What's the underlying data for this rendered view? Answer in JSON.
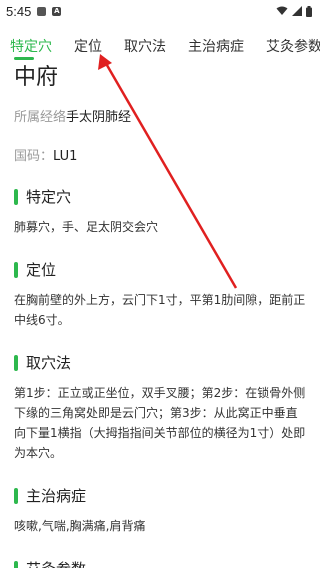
{
  "status_bar": {
    "time": "5:45",
    "left_icons": [
      "image-icon",
      "a-app-icon"
    ],
    "right_icons": [
      "wifi-icon",
      "signal-icon",
      "battery-icon"
    ]
  },
  "tabs": [
    {
      "label": "特定穴",
      "active": true
    },
    {
      "label": "定位",
      "active": false
    },
    {
      "label": "取穴法",
      "active": false
    },
    {
      "label": "主治病症",
      "active": false
    },
    {
      "label": "艾灸参数",
      "active": false
    }
  ],
  "point": {
    "name": "中府",
    "meridian_key": "所属经络",
    "meridian_value": "手太阴肺经",
    "code_key": "国码：",
    "code_value": "LU1"
  },
  "sections": [
    {
      "title": "特定穴",
      "body": "肺募穴，手、足太阴交会穴"
    },
    {
      "title": "定位",
      "body": "在胸前壁的外上方，云门下1寸，平第1肋间隙，距前正中线6寸。"
    },
    {
      "title": "取穴法",
      "body": "第1步：正立或正坐位，双手叉腰；第2步：在锁骨外侧下缘的三角窝处即是云门穴；第3步：从此窝正中垂直向下量1横指（大拇指指间关节部位的横径为1寸）处即为本穴。"
    },
    {
      "title": "主治病症",
      "body": "咳嗽,气喘,胸满痛,肩背痛"
    },
    {
      "title": "艾灸参数",
      "body": ""
    }
  ],
  "colors": {
    "accent": "#2db84d",
    "annotation_arrow": "#e02020"
  }
}
